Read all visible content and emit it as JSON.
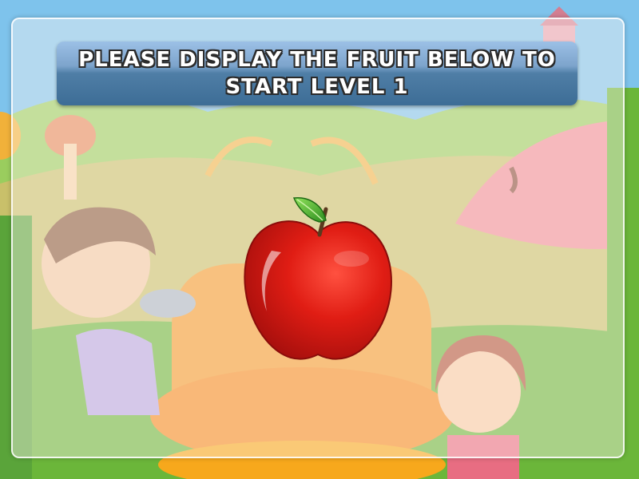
{
  "banner": {
    "instruction": "Please display the fruit below to start level 1"
  },
  "target_fruit": {
    "icon": "apple-icon",
    "body_color": "#d81a12",
    "leaf_color": "#3fae2a"
  },
  "colors": {
    "banner_top": "#9cc0e6",
    "banner_bottom": "#3d6d96",
    "sky": "#7ec3ec",
    "grass": "#6bb63a"
  }
}
